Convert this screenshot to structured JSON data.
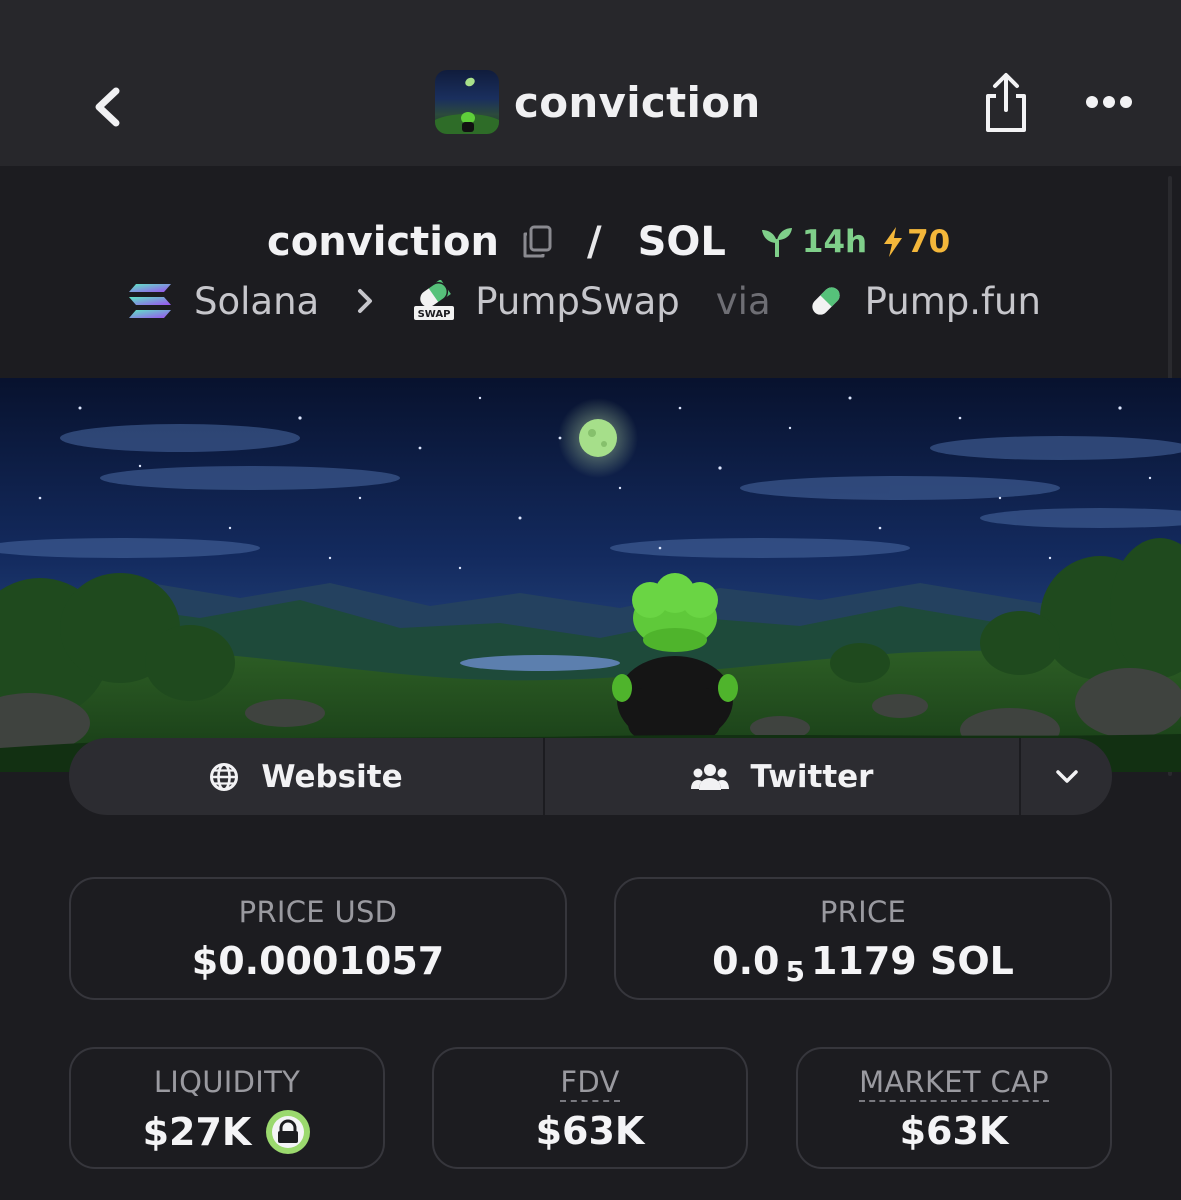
{
  "header": {
    "title": "conviction"
  },
  "pair": {
    "base": "conviction",
    "separator": "/",
    "quote": "SOL",
    "age": "14h",
    "boosts": "70",
    "chain": "Solana",
    "dex": "PumpSwap",
    "via": "via",
    "launchpad": "Pump.fun",
    "swap_badge": "SWAP"
  },
  "links": {
    "website": "Website",
    "twitter": "Twitter"
  },
  "stats": {
    "price_usd_label": "PRICE USD",
    "price_usd_value": "$0.0001057",
    "price_label": "PRICE",
    "price_prefix": "0.0",
    "price_zeros": "5",
    "price_suffix": "1179 SOL",
    "liquidity_label": "LIQUIDITY",
    "liquidity_value": "$27K",
    "fdv_label": "FDV",
    "fdv_value": "$63K",
    "mcap_label": "MARKET CAP",
    "mcap_value": "$63K"
  },
  "colors": {
    "background": "#1c1c20",
    "topbar": "#27272b",
    "age_green": "#7fcf8a",
    "boost_orange": "#f4b73a",
    "liquidity_lock": "#9bd96e"
  },
  "icons": [
    "back-arrow-icon",
    "share-icon",
    "more-icon",
    "copy-icon",
    "sprout-icon",
    "bolt-icon",
    "solana-icon",
    "chevron-right-icon",
    "swap-icon",
    "pill-icon",
    "globe-icon",
    "users-icon",
    "chevron-down-icon",
    "lock-icon"
  ]
}
